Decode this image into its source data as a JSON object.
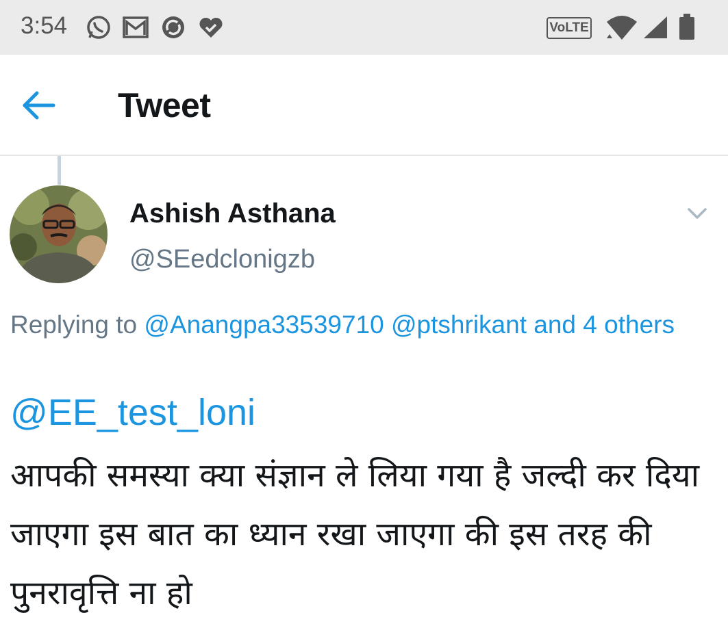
{
  "status_bar": {
    "time": "3:54",
    "network_badge": "VoLTE",
    "icons": [
      "whatsapp-icon",
      "gmail-icon",
      "sync-app-icon",
      "heart-check-icon",
      "wifi-icon",
      "cell-signal-icon",
      "battery-icon"
    ]
  },
  "app_bar": {
    "title": "Tweet",
    "back_icon": "arrow-left-icon",
    "accent": "#1b95e0"
  },
  "tweet": {
    "author_name": "Ashish Asthana",
    "author_handle": "@SEedclonigzb",
    "replying_prefix": "Replying to",
    "replying_to": [
      "@Anangpa33539710",
      "@ptshrikant"
    ],
    "replying_others": "and 4 others",
    "mention": "@EE_test_loni",
    "body": "आपकी समस्या क्या संज्ञान ले लिया गया है जल्दी कर दिया जाएगा इस बात का ध्यान रखा जाएगा की इस तरह की पुनरावृत्ति ना हो",
    "menu_icon": "chevron-down-icon"
  },
  "colors": {
    "link": "#1b95e0",
    "secondary_text": "#657786",
    "primary_text": "#14171a",
    "status_bar_bg": "#ebebeb"
  }
}
